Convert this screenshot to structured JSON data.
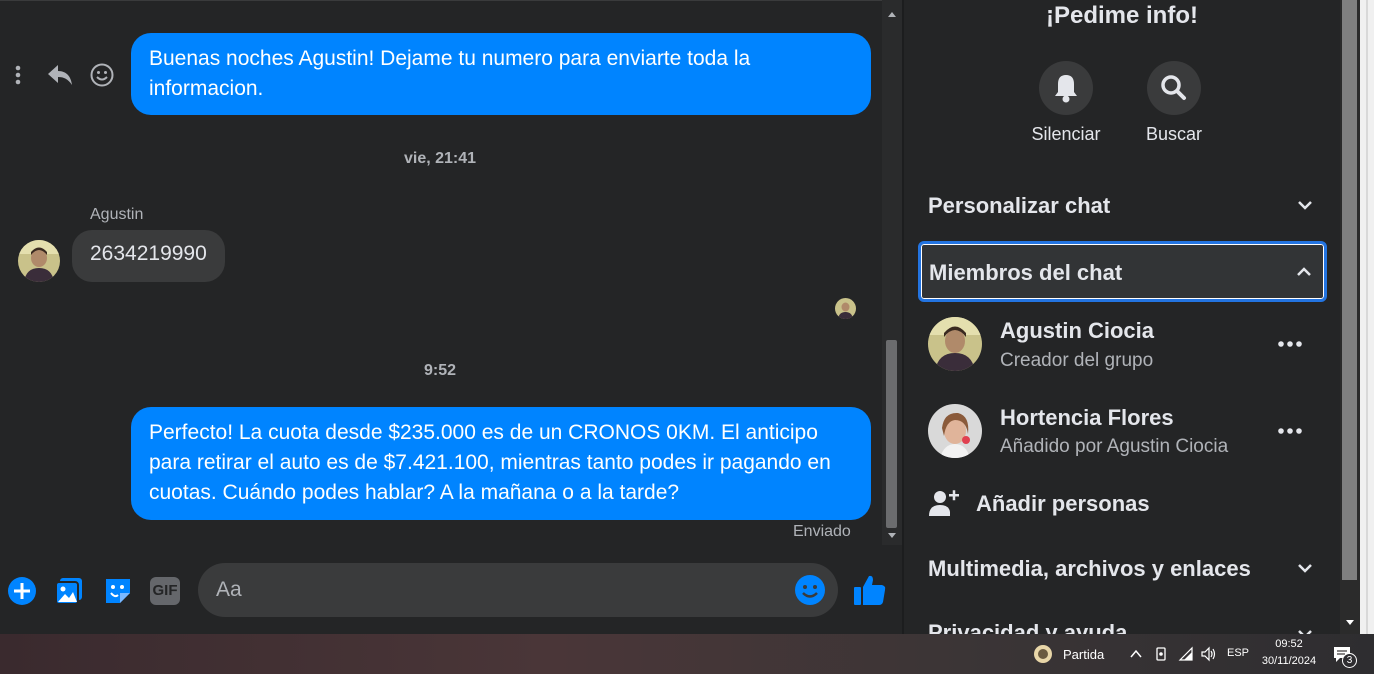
{
  "chat": {
    "messages": {
      "first_out": "Buenas noches Agustin! Dejame tu numero para enviarte toda la informacion.",
      "timestamp_1": "vie, 21:41",
      "sender_name": "Agustin",
      "incoming": "2634219990",
      "timestamp_2": "9:52",
      "second_out": "Perfecto! La cuota desde $235.000 es de un CRONOS 0KM. El anticipo para retirar el auto es de $7.421.100, mientras tanto podes ir pagando en cuotas. Cuándo podes hablar? A la mañana o a la tarde?",
      "status": "Enviado"
    },
    "composer": {
      "placeholder": "Aa"
    },
    "toolbar": {
      "gif_label": "GIF"
    }
  },
  "sidebar": {
    "title": "¡Pedime info!",
    "actions": [
      {
        "label": "Silenciar",
        "icon": "bell-icon"
      },
      {
        "label": "Buscar",
        "icon": "search-icon"
      }
    ],
    "sections": {
      "customize": "Personalizar chat",
      "members": "Miembros del chat",
      "media": "Multimedia, archivos y enlaces",
      "privacy": "Privacidad y ayuda"
    },
    "members": [
      {
        "name": "Agustin Ciocia",
        "subtitle": "Creador del grupo"
      },
      {
        "name": "Hortencia Flores",
        "subtitle": "Añadido por Agustin Ciocia"
      }
    ],
    "add_people": "Añadir personas"
  },
  "taskbar": {
    "weather": "Partida",
    "language": "ESP",
    "time": "09:52",
    "date": "30/11/2024",
    "notifications": "3"
  },
  "colors": {
    "accent": "#0084ff",
    "background": "#242526",
    "bubble_in": "#3a3b3c",
    "focus_ring": "#2374e1"
  }
}
